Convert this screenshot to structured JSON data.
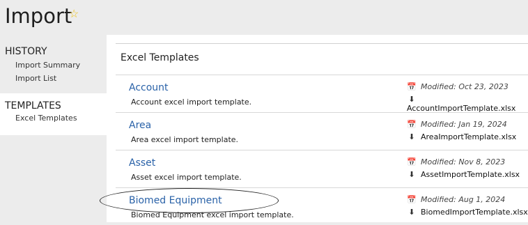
{
  "page": {
    "title": "Import",
    "star_icon": "star-outline-icon"
  },
  "sidebar": {
    "history": {
      "heading": "HISTORY",
      "items": [
        "Import Summary",
        "Import List"
      ]
    },
    "templates": {
      "heading": "TEMPLATES",
      "items": [
        "Excel Templates"
      ]
    }
  },
  "main": {
    "title": "Excel Templates",
    "rows": [
      {
        "name": "Account",
        "desc": "Account excel import template.",
        "modified": "Modified: Oct 23, 2023",
        "file": "AccountImportTemplate.xlsx"
      },
      {
        "name": "Area",
        "desc": "Area excel import template.",
        "modified": "Modified: Jan 19, 2024",
        "file": "AreaImportTemplate.xlsx"
      },
      {
        "name": "Asset",
        "desc": "Asset excel import template.",
        "modified": "Modified: Nov 8, 2023",
        "file": "AssetImportTemplate.xlsx"
      },
      {
        "name": "Biomed Equipment",
        "desc": "Biomed Equipment excel import template.",
        "modified": "Modified: Aug 1, 2024",
        "file": "BiomedImportTemplate.xlsx"
      }
    ]
  },
  "colors": {
    "link": "#2a62a8",
    "star": "#f0c419",
    "background": "#ececec"
  }
}
